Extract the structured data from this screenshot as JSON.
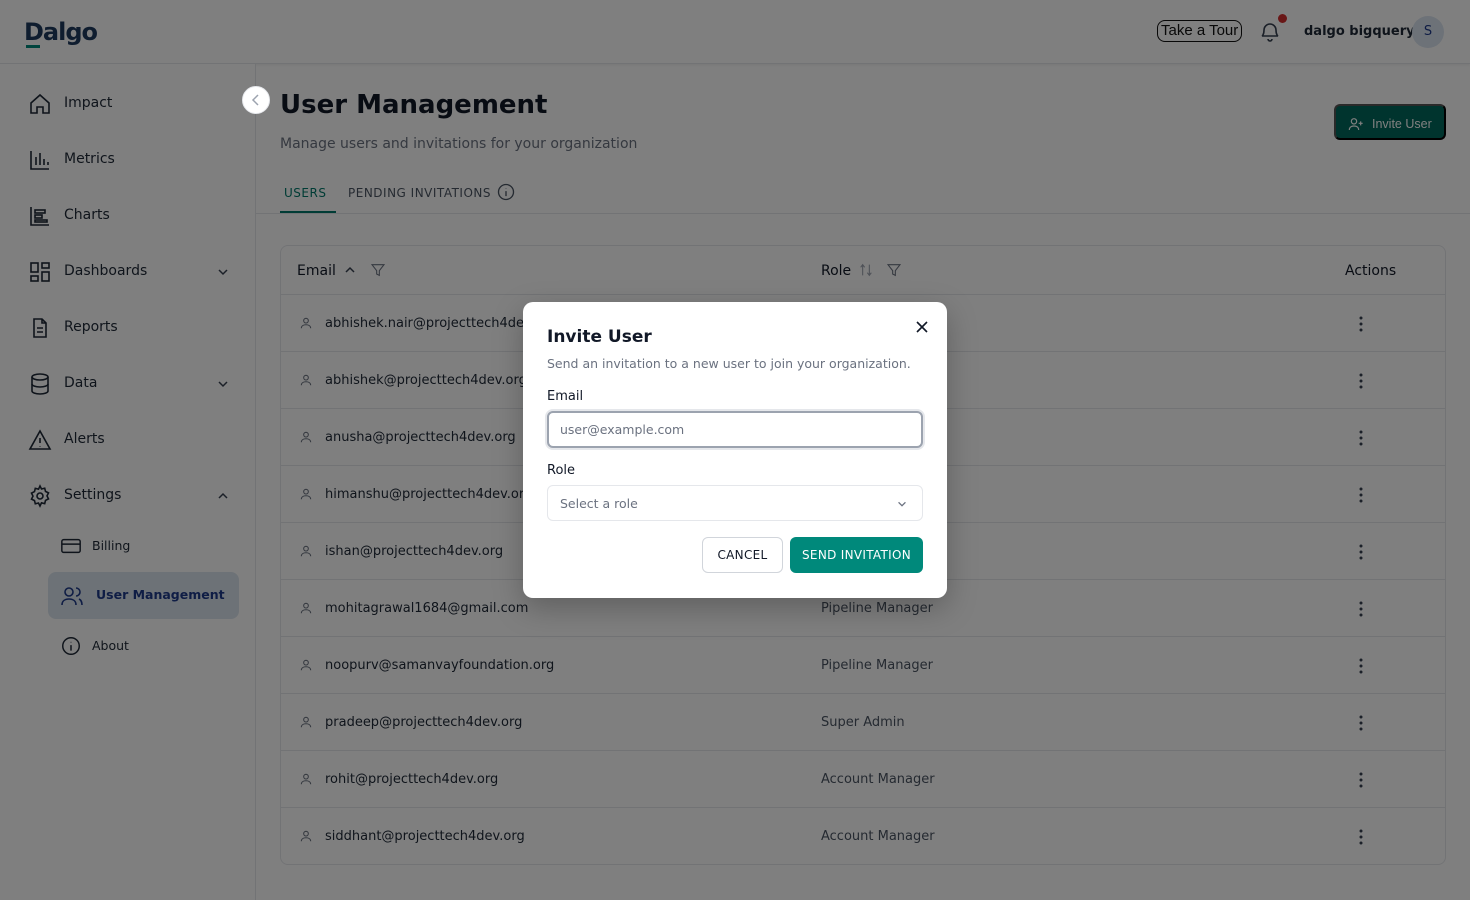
{
  "header": {
    "logo": "Dalgo",
    "tour_label": "Take a Tour",
    "username": "dalgo bigquery",
    "avatar_initial": "S"
  },
  "sidebar": {
    "items": [
      {
        "label": "Impact",
        "icon": "home-icon"
      },
      {
        "label": "Metrics",
        "icon": "bar-chart-icon"
      },
      {
        "label": "Charts",
        "icon": "chart-icon"
      },
      {
        "label": "Dashboards",
        "icon": "dashboard-icon"
      },
      {
        "label": "Reports",
        "icon": "report-icon"
      },
      {
        "label": "Data",
        "icon": "database-icon"
      },
      {
        "label": "Alerts",
        "icon": "alert-icon"
      },
      {
        "label": "Settings",
        "icon": "gear-icon"
      }
    ],
    "settings_children": [
      {
        "label": "Billing",
        "icon": "credit-card-icon"
      },
      {
        "label": "User Management",
        "icon": "users-icon",
        "active": true
      },
      {
        "label": "About",
        "icon": "info-icon"
      }
    ]
  },
  "main": {
    "title": "User Management",
    "subtitle": "Manage users and invitations for your organization",
    "invite_button": "Invite User",
    "tabs": [
      {
        "label": "USERS",
        "active": true
      },
      {
        "label": "PENDING INVITATIONS"
      }
    ],
    "table": {
      "headers": {
        "email": "Email",
        "role": "Role",
        "actions": "Actions"
      },
      "rows": [
        {
          "email": "abhishek.nair@projecttech4dev.org",
          "role": ""
        },
        {
          "email": "abhishek@projecttech4dev.org",
          "role": ""
        },
        {
          "email": "anusha@projecttech4dev.org",
          "role": ""
        },
        {
          "email": "himanshu@projecttech4dev.org",
          "role": ""
        },
        {
          "email": "ishan@projecttech4dev.org",
          "role": ""
        },
        {
          "email": "mohitagrawal1684@gmail.com",
          "role": "Pipeline Manager"
        },
        {
          "email": "noopurv@samanvayfoundation.org",
          "role": "Pipeline Manager"
        },
        {
          "email": "pradeep@projecttech4dev.org",
          "role": "Super Admin"
        },
        {
          "email": "rohit@projecttech4dev.org",
          "role": "Account Manager"
        },
        {
          "email": "siddhant@projecttech4dev.org",
          "role": "Account Manager"
        }
      ]
    }
  },
  "modal": {
    "title": "Invite User",
    "subtitle": "Send an invitation to a new user to join your organization.",
    "email_label": "Email",
    "email_placeholder": "user@example.com",
    "email_value": "",
    "role_label": "Role",
    "role_placeholder": "Select a role",
    "cancel_label": "CANCEL",
    "send_label": "SEND INVITATION"
  },
  "colors": {
    "accent": "#00897b",
    "accent_dark": "#00695c",
    "brand": "#1e3a5f",
    "notification": "#d32f2f"
  }
}
